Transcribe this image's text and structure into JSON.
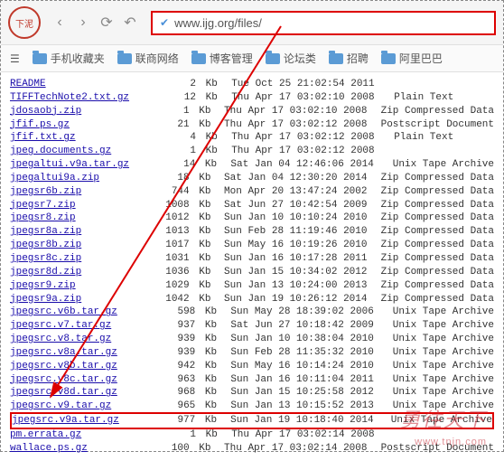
{
  "url": "www.ijg.org/files/",
  "bookmarks": [
    "手机收藏夹",
    "联商网络",
    "博客管理",
    "论坛类",
    "招聘",
    "阿里巴巴"
  ],
  "files": [
    {
      "name": "README",
      "size": "2",
      "unit": "Kb",
      "date": "Tue Oct 25 21:02:54 2011",
      "type": ""
    },
    {
      "name": "TIFFTechNote2.txt.gz",
      "size": "12",
      "unit": "Kb",
      "date": "Thu Apr 17 03:02:10 2008",
      "type": "Plain Text"
    },
    {
      "name": "jdosaobj.zip",
      "size": "1",
      "unit": "Kb",
      "date": "Thu Apr 17 03:02:10 2008",
      "type": "Zip Compressed Data"
    },
    {
      "name": "jfif.ps.gz",
      "size": "21",
      "unit": "Kb",
      "date": "Thu Apr 17 03:02:12 2008",
      "type": "Postscript Document"
    },
    {
      "name": "jfif.txt.gz",
      "size": "4",
      "unit": "Kb",
      "date": "Thu Apr 17 03:02:12 2008",
      "type": "Plain Text"
    },
    {
      "name": "jpeg.documents.gz",
      "size": "1",
      "unit": "Kb",
      "date": "Thu Apr 17 03:02:12 2008",
      "type": ""
    },
    {
      "name": "jpegaltui.v9a.tar.gz",
      "size": "14",
      "unit": "Kb",
      "date": "Sat Jan 04 12:46:06 2014",
      "type": "Unix Tape Archive"
    },
    {
      "name": "jpegaltui9a.zip",
      "size": "18",
      "unit": "Kb",
      "date": "Sat Jan 04 12:30:20 2014",
      "type": "Zip Compressed Data"
    },
    {
      "name": "jpegsr6b.zip",
      "size": "744",
      "unit": "Kb",
      "date": "Mon Apr 20 13:47:24 2002",
      "type": "Zip Compressed Data"
    },
    {
      "name": "jpegsr7.zip",
      "size": "1008",
      "unit": "Kb",
      "date": "Sat Jun 27 10:42:54 2009",
      "type": "Zip Compressed Data"
    },
    {
      "name": "jpegsr8.zip",
      "size": "1012",
      "unit": "Kb",
      "date": "Sun Jan 10 10:10:24 2010",
      "type": "Zip Compressed Data"
    },
    {
      "name": "jpegsr8a.zip",
      "size": "1013",
      "unit": "Kb",
      "date": "Sun Feb 28 11:19:46 2010",
      "type": "Zip Compressed Data"
    },
    {
      "name": "jpegsr8b.zip",
      "size": "1017",
      "unit": "Kb",
      "date": "Sun May 16 10:19:26 2010",
      "type": "Zip Compressed Data"
    },
    {
      "name": "jpegsr8c.zip",
      "size": "1031",
      "unit": "Kb",
      "date": "Sun Jan 16 10:17:28 2011",
      "type": "Zip Compressed Data"
    },
    {
      "name": "jpegsr8d.zip",
      "size": "1036",
      "unit": "Kb",
      "date": "Sun Jan 15 10:34:02 2012",
      "type": "Zip Compressed Data"
    },
    {
      "name": "jpegsr9.zip",
      "size": "1029",
      "unit": "Kb",
      "date": "Sun Jan 13 10:24:00 2013",
      "type": "Zip Compressed Data"
    },
    {
      "name": "jpegsr9a.zip",
      "size": "1042",
      "unit": "Kb",
      "date": "Sun Jan 19 10:26:12 2014",
      "type": "Zip Compressed Data"
    },
    {
      "name": "jpegsrc.v6b.tar.gz",
      "size": "598",
      "unit": "Kb",
      "date": "Sun May 28 18:39:02 2006",
      "type": "Unix Tape Archive"
    },
    {
      "name": "jpegsrc.v7.tar.gz",
      "size": "937",
      "unit": "Kb",
      "date": "Sat Jun 27 10:18:42 2009",
      "type": "Unix Tape Archive"
    },
    {
      "name": "jpegsrc.v8.tar.gz",
      "size": "939",
      "unit": "Kb",
      "date": "Sun Jan 10 10:38:04 2010",
      "type": "Unix Tape Archive"
    },
    {
      "name": "jpegsrc.v8a.tar.gz",
      "size": "939",
      "unit": "Kb",
      "date": "Sun Feb 28 11:35:32 2010",
      "type": "Unix Tape Archive"
    },
    {
      "name": "jpegsrc.v8b.tar.gz",
      "size": "942",
      "unit": "Kb",
      "date": "Sun May 16 10:14:24 2010",
      "type": "Unix Tape Archive"
    },
    {
      "name": "jpegsrc.v8c.tar.gz",
      "size": "963",
      "unit": "Kb",
      "date": "Sun Jan 16 10:11:04 2011",
      "type": "Unix Tape Archive"
    },
    {
      "name": "jpegsrc.v8d.tar.gz",
      "size": "968",
      "unit": "Kb",
      "date": "Sun Jan 15 10:25:58 2012",
      "type": "Unix Tape Archive"
    },
    {
      "name": "jpegsrc.v9.tar.gz",
      "size": "965",
      "unit": "Kb",
      "date": "Sun Jan 13 10:15:52 2013",
      "type": "Unix Tape Archive"
    },
    {
      "name": "jpegsrc.v9a.tar.gz",
      "size": "977",
      "unit": "Kb",
      "date": "Sun Jan 19 10:18:40 2014",
      "type": "Unix Tape Archive",
      "highlight": true
    },
    {
      "name": "pm.errata.gz",
      "size": "1",
      "unit": "Kb",
      "date": "Thu Apr 17 03:02:14 2008",
      "type": ""
    },
    {
      "name": "wallace.ps.gz",
      "size": "100",
      "unit": "Kb",
      "date": "Thu Apr 17 03:02:14 2008",
      "type": "Postscript Document"
    }
  ],
  "watermark": {
    "main": "勇往天下",
    "sub": "www.tnjn.com"
  }
}
